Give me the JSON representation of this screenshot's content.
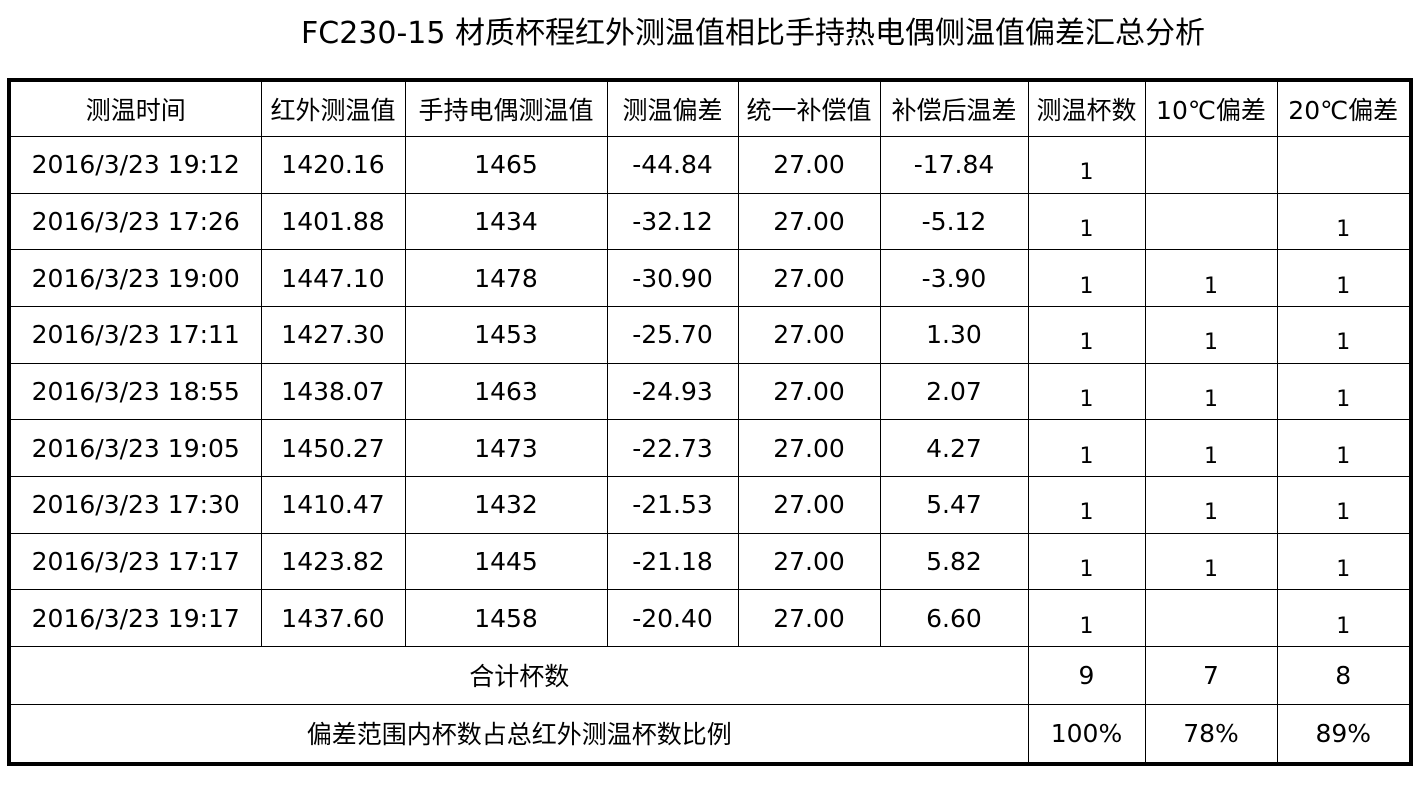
{
  "title": "FC230-15 材质杯程红外测温值相比手持热电偶侧温值偏差汇总分析",
  "headers": [
    "测温时间",
    "红外测温值",
    "手持电偶测温值",
    "测温偏差",
    "统一补偿值",
    "补偿后温差",
    "测温杯数",
    "10℃偏差",
    "20℃偏差"
  ],
  "rows": [
    {
      "time": "2016/3/23 19:12",
      "ir": "1420.16",
      "tc": "1465",
      "dev": "-44.84",
      "comp": "27.00",
      "after": "-17.84",
      "cups": "1",
      "d10": "",
      "d20": ""
    },
    {
      "time": "2016/3/23 17:26",
      "ir": "1401.88",
      "tc": "1434",
      "dev": "-32.12",
      "comp": "27.00",
      "after": "-5.12",
      "cups": "1",
      "d10": "",
      "d20": "1"
    },
    {
      "time": "2016/3/23 19:00",
      "ir": "1447.10",
      "tc": "1478",
      "dev": "-30.90",
      "comp": "27.00",
      "after": "-3.90",
      "cups": "1",
      "d10": "1",
      "d20": "1"
    },
    {
      "time": "2016/3/23 17:11",
      "ir": "1427.30",
      "tc": "1453",
      "dev": "-25.70",
      "comp": "27.00",
      "after": "1.30",
      "cups": "1",
      "d10": "1",
      "d20": "1"
    },
    {
      "time": "2016/3/23 18:55",
      "ir": "1438.07",
      "tc": "1463",
      "dev": "-24.93",
      "comp": "27.00",
      "after": "2.07",
      "cups": "1",
      "d10": "1",
      "d20": "1"
    },
    {
      "time": "2016/3/23 19:05",
      "ir": "1450.27",
      "tc": "1473",
      "dev": "-22.73",
      "comp": "27.00",
      "after": "4.27",
      "cups": "1",
      "d10": "1",
      "d20": "1"
    },
    {
      "time": "2016/3/23 17:30",
      "ir": "1410.47",
      "tc": "1432",
      "dev": "-21.53",
      "comp": "27.00",
      "after": "5.47",
      "cups": "1",
      "d10": "1",
      "d20": "1"
    },
    {
      "time": "2016/3/23 17:17",
      "ir": "1423.82",
      "tc": "1445",
      "dev": "-21.18",
      "comp": "27.00",
      "after": "5.82",
      "cups": "1",
      "d10": "1",
      "d20": "1"
    },
    {
      "time": "2016/3/23 19:17",
      "ir": "1437.60",
      "tc": "1458",
      "dev": "-20.40",
      "comp": "27.00",
      "after": "6.60",
      "cups": "1",
      "d10": "",
      "d20": "1"
    }
  ],
  "totals": {
    "label": "合计杯数",
    "cups": "9",
    "d10": "7",
    "d20": "8"
  },
  "ratio": {
    "label": "偏差范围内杯数占总红外测温杯数比例",
    "cups": "100%",
    "d10": "78%",
    "d20": "89%"
  }
}
